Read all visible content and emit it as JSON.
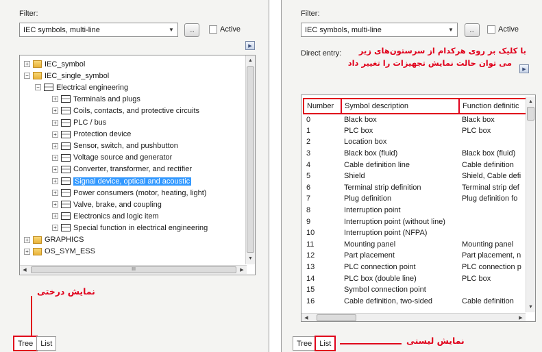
{
  "left": {
    "filter_label": "Filter:",
    "filter_value": "IEC symbols, multi-line",
    "more_button": "...",
    "active_label": "Active",
    "tree": [
      {
        "label": "IEC_symbol",
        "kind": "folder",
        "exp": "+",
        "level": 0
      },
      {
        "label": "IEC_single_symbol",
        "kind": "folder",
        "exp": "−",
        "level": 0
      },
      {
        "label": "Electrical engineering",
        "kind": "printer",
        "exp": "−",
        "level": 1
      },
      {
        "label": "Terminals and plugs",
        "kind": "printer",
        "exp": "+",
        "level": 2
      },
      {
        "label": "Coils, contacts, and protective circuits",
        "kind": "printer",
        "exp": "+",
        "level": 2
      },
      {
        "label": "PLC / bus",
        "kind": "printer",
        "exp": "+",
        "level": 2
      },
      {
        "label": "Protection device",
        "kind": "printer",
        "exp": "+",
        "level": 2
      },
      {
        "label": "Sensor, switch, and pushbutton",
        "kind": "printer",
        "exp": "+",
        "level": 2
      },
      {
        "label": "Voltage source and generator",
        "kind": "printer",
        "exp": "+",
        "level": 2
      },
      {
        "label": "Converter, transformer, and rectifier",
        "kind": "printer",
        "exp": "+",
        "level": 2
      },
      {
        "label": "Signal device, optical and acoustic",
        "kind": "printer",
        "exp": "+",
        "level": 2,
        "selected": true
      },
      {
        "label": "Power consumers (motor, heating, light)",
        "kind": "printer",
        "exp": "+",
        "level": 2
      },
      {
        "label": "Valve, brake, and coupling",
        "kind": "printer",
        "exp": "+",
        "level": 2
      },
      {
        "label": "Electronics and logic item",
        "kind": "printer",
        "exp": "+",
        "level": 2
      },
      {
        "label": "Special function in electrical engineering",
        "kind": "printer",
        "exp": "+",
        "level": 2
      },
      {
        "label": "GRAPHICS",
        "kind": "folder",
        "exp": "+",
        "level": 0
      },
      {
        "label": "OS_SYM_ESS",
        "kind": "folder",
        "exp": "+",
        "level": 0
      }
    ],
    "scroll_thumb_label": "III",
    "annotation": "نمایش درختی",
    "tabs": [
      "Tree",
      "List"
    ]
  },
  "right": {
    "filter_label": "Filter:",
    "filter_value": "IEC symbols, multi-line",
    "more_button": "...",
    "active_label": "Active",
    "direct_entry_label": "Direct entry:",
    "annotation_top_1": "با کلیک بر روی هرکدام از سرستون‌های زیر",
    "annotation_top_2": "می توان حالت نمایش تجهیزات را تغییر داد",
    "columns": [
      "Number",
      "Symbol description",
      "Function definitic"
    ],
    "rows": [
      [
        "0",
        "Black box",
        "Black box"
      ],
      [
        "1",
        "PLC box",
        "PLC box"
      ],
      [
        "2",
        "Location box",
        ""
      ],
      [
        "3",
        "Black box (fluid)",
        "Black box (fluid)"
      ],
      [
        "4",
        "Cable definition line",
        "Cable definition"
      ],
      [
        "5",
        "Shield",
        "Shield, Cable defi"
      ],
      [
        "6",
        "Terminal strip definition",
        "Terminal strip def"
      ],
      [
        "7",
        "Plug definition",
        "Plug definition fo"
      ],
      [
        "8",
        "Interruption point",
        ""
      ],
      [
        "9",
        "Interruption point (without line)",
        ""
      ],
      [
        "10",
        "Interruption point (NFPA)",
        ""
      ],
      [
        "11",
        "Mounting panel",
        "Mounting panel"
      ],
      [
        "12",
        "Part placement",
        "Part placement, n"
      ],
      [
        "13",
        "PLC connection point",
        "PLC connection p"
      ],
      [
        "14",
        "PLC box (double line)",
        "PLC box"
      ],
      [
        "15",
        "Symbol connection point",
        ""
      ],
      [
        "16",
        "Cable definition, two-sided",
        "Cable definition"
      ]
    ],
    "annotation_bottom": "نمایش لیستی",
    "tabs": [
      "Tree",
      "List"
    ]
  },
  "colors": {
    "annotation_red": "#e0001b",
    "selection_blue": "#3399ff",
    "panel_bg": "#f4f4f2"
  }
}
